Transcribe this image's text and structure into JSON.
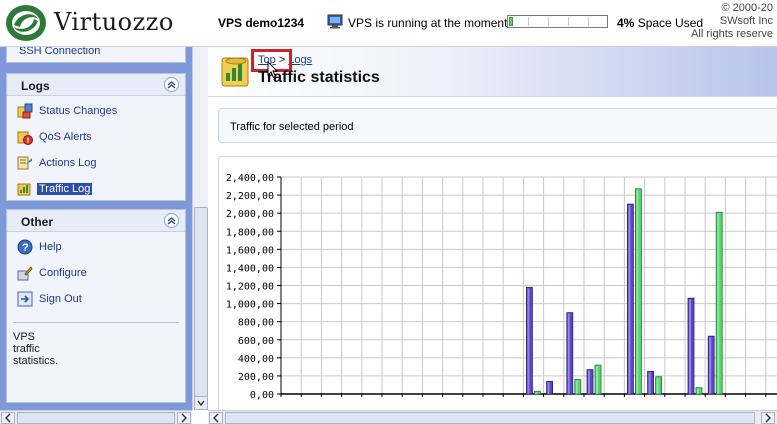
{
  "header": {
    "logo_text": "Virtuozzo",
    "vps_name": "VPS demo1234",
    "status_text": "VPS is running at the moment",
    "space_percent": 4,
    "space_percent_label": "4%",
    "space_label": "Space Used",
    "copyright_lines": [
      "© 2000-20",
      "SWsoft Inc",
      "All rights reserve"
    ]
  },
  "sidebar": {
    "clipped_item": "SSH Connection",
    "logs": {
      "title": "Logs",
      "items": [
        {
          "label": "Status Changes",
          "icon": "status-changes-icon"
        },
        {
          "label": "QoS Alerts",
          "icon": "qos-alerts-icon"
        },
        {
          "label": "Actions Log",
          "icon": "actions-log-icon"
        },
        {
          "label": "Traffic Log",
          "icon": "traffic-log-icon",
          "selected": true
        }
      ]
    },
    "other": {
      "title": "Other",
      "items": [
        {
          "label": "Help",
          "icon": "help-icon"
        },
        {
          "label": "Configure",
          "icon": "configure-icon"
        },
        {
          "label": "Sign Out",
          "icon": "sign-out-icon"
        }
      ],
      "description": "VPS traffic statistics."
    }
  },
  "main": {
    "breadcrumb": {
      "top": "Top",
      "separator": ">",
      "logs": "Logs"
    },
    "title": "Traffic statistics",
    "period_label": "Traffic for selected period"
  },
  "colors": {
    "sidebar_bg": "#7f98d8",
    "selected_bg": "#2b4fae",
    "bar_purple": "#5b45c9",
    "bar_green": "#55d66a",
    "highlight_red": "#d0212a"
  },
  "chart_data": {
    "type": "bar",
    "title": "",
    "xlabel": "",
    "ylabel": "",
    "ylim": [
      0,
      2400
    ],
    "y_ticks": [
      "0,00",
      "200,00",
      "400,00",
      "600,00",
      "800,00",
      "1,000,00",
      "1,200,00",
      "1,400,00",
      "1,600,00",
      "1,800,00",
      "2,000,00",
      "2,200,00",
      "2,400,00"
    ],
    "grid": true,
    "series": [
      {
        "color": "#5b45c9",
        "values": [
          0,
          0,
          0,
          0,
          0,
          0,
          0,
          0,
          0,
          0,
          0,
          0,
          1180,
          140,
          900,
          270,
          0,
          2100,
          250,
          0,
          1060,
          640,
          0,
          0,
          0,
          0,
          0
        ]
      },
      {
        "color": "#55d66a",
        "values": [
          0,
          0,
          0,
          0,
          0,
          0,
          0,
          0,
          0,
          0,
          0,
          0,
          30,
          0,
          160,
          320,
          0,
          2270,
          190,
          0,
          70,
          2010,
          0,
          0,
          0,
          0,
          0
        ]
      }
    ]
  }
}
